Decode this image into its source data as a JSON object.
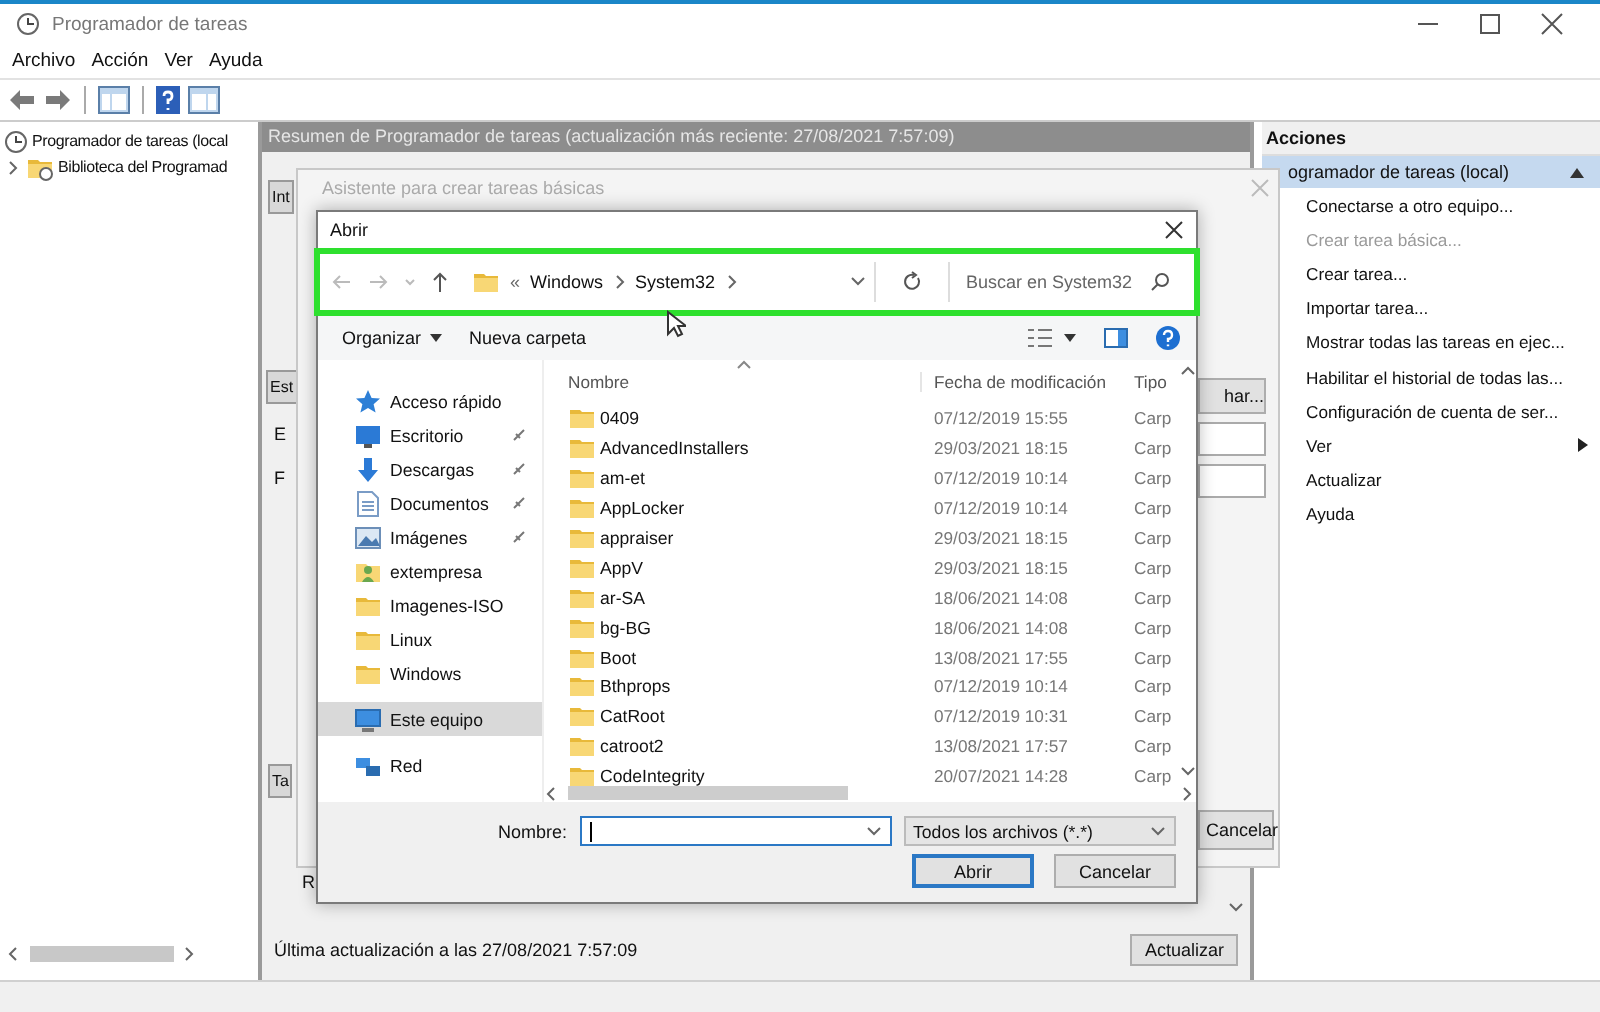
{
  "window": {
    "title": "Programador de tareas"
  },
  "menu": [
    "Archivo",
    "Acción",
    "Ver",
    "Ayuda"
  ],
  "tree": [
    {
      "label": "Programador de tareas (local",
      "children": [
        {
          "label": "Biblioteca del Programad",
          "expanded": false
        }
      ]
    }
  ],
  "center": {
    "header": "Resumen de Programador de tareas (actualización más reciente: 27/08/2021 7:57:09)",
    "fragments": [
      {
        "kind": "tab",
        "text": "Int"
      },
      {
        "kind": "tab",
        "text": "Est"
      },
      {
        "kind": "text",
        "text": "E"
      },
      {
        "kind": "text",
        "text": "F"
      },
      {
        "kind": "tab",
        "text": "Ta"
      },
      {
        "kind": "text",
        "text": "R"
      }
    ],
    "last_update": "Última actualización a las 27/08/2021 7:57:09",
    "refresh_button": "Actualizar"
  },
  "wizard": {
    "title": "Asistente para crear tareas básicas",
    "browse_button": "har...",
    "cancel_button": "Cancelar"
  },
  "open_dialog": {
    "title": "Abrir",
    "address_bar": {
      "highlighted": true,
      "overflow_mark": "«",
      "path": [
        "Windows",
        "System32"
      ]
    },
    "search": {
      "placeholder": "Buscar en System32"
    },
    "toolbar": {
      "organize": "Organizar",
      "new_folder": "Nueva carpeta"
    },
    "nav": [
      {
        "kind": "star",
        "label": "Acceso rápido",
        "pinned": false,
        "selected": false
      },
      {
        "kind": "desktop",
        "label": "Escritorio",
        "pinned": true,
        "selected": false
      },
      {
        "kind": "download",
        "label": "Descargas",
        "pinned": true,
        "selected": false
      },
      {
        "kind": "document",
        "label": "Documentos",
        "pinned": true,
        "selected": false
      },
      {
        "kind": "pictures",
        "label": "Imágenes",
        "pinned": true,
        "selected": false
      },
      {
        "kind": "user",
        "label": "extempresa",
        "pinned": false,
        "selected": false
      },
      {
        "kind": "folder",
        "label": "Imagenes-ISO",
        "pinned": false,
        "selected": false
      },
      {
        "kind": "folder",
        "label": "Linux",
        "pinned": false,
        "selected": false
      },
      {
        "kind": "folder",
        "label": "Windows",
        "pinned": false,
        "selected": false
      },
      {
        "kind": "computer",
        "label": "Este equipo",
        "pinned": false,
        "selected": true
      },
      {
        "kind": "network",
        "label": "Red",
        "pinned": false,
        "selected": false
      }
    ],
    "columns": [
      "Nombre",
      "Fecha de modificación",
      "Tipo"
    ],
    "files": [
      {
        "name": "0409",
        "date": "07/12/2019 15:55",
        "type": "Carp"
      },
      {
        "name": "AdvancedInstallers",
        "date": "29/03/2021 18:15",
        "type": "Carp"
      },
      {
        "name": "am-et",
        "date": "07/12/2019 10:14",
        "type": "Carp"
      },
      {
        "name": "AppLocker",
        "date": "07/12/2019 10:14",
        "type": "Carp"
      },
      {
        "name": "appraiser",
        "date": "29/03/2021 18:15",
        "type": "Carp"
      },
      {
        "name": "AppV",
        "date": "29/03/2021 18:15",
        "type": "Carp"
      },
      {
        "name": "ar-SA",
        "date": "18/06/2021 14:08",
        "type": "Carp"
      },
      {
        "name": "bg-BG",
        "date": "18/06/2021 14:08",
        "type": "Carp"
      },
      {
        "name": "Boot",
        "date": "13/08/2021 17:55",
        "type": "Carp"
      },
      {
        "name": "Bthprops",
        "date": "07/12/2019 10:14",
        "type": "Carp"
      },
      {
        "name": "CatRoot",
        "date": "07/12/2019 10:31",
        "type": "Carp"
      },
      {
        "name": "catroot2",
        "date": "13/08/2021 17:57",
        "type": "Carp"
      },
      {
        "name": "CodeIntegrity",
        "date": "20/07/2021 14:28",
        "type": "Carp"
      }
    ],
    "filename_label": "Nombre:",
    "filter": "Todos los archivos (*.*)",
    "buttons": [
      {
        "label": "Abrir",
        "default": true
      },
      {
        "label": "Cancelar",
        "default": false
      }
    ]
  },
  "actions": {
    "title": "Acciones",
    "section": "ogramador de tareas (local)",
    "items": [
      {
        "label": "Conectarse a otro equipo...",
        "disabled": false,
        "has_submenu": false
      },
      {
        "label": "Crear tarea básica...",
        "disabled": true,
        "has_submenu": false
      },
      {
        "label": "Crear tarea...",
        "disabled": false,
        "has_submenu": false
      },
      {
        "label": "Importar tarea...",
        "disabled": false,
        "has_submenu": false
      },
      {
        "label": "Mostrar todas las tareas en ejec...",
        "disabled": false,
        "has_submenu": false
      },
      {
        "label": "Habilitar el historial de todas las...",
        "disabled": false,
        "has_submenu": false
      },
      {
        "label": "Configuración de cuenta de ser...",
        "disabled": false,
        "has_submenu": false
      },
      {
        "label": "Ver",
        "disabled": false,
        "has_submenu": true
      },
      {
        "label": "Actualizar",
        "disabled": false,
        "has_submenu": false
      },
      {
        "label": "Ayuda",
        "disabled": false,
        "has_submenu": false
      }
    ]
  }
}
